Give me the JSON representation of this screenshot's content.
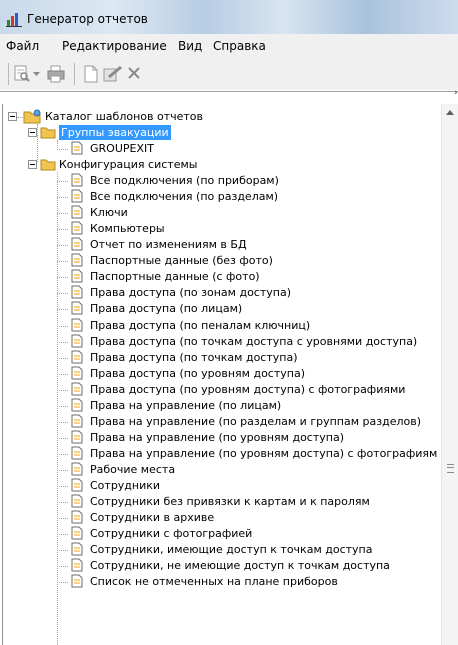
{
  "window": {
    "title": "Генератор отчетов"
  },
  "menu": [
    "Файл",
    "Редактирование",
    "Вид",
    "Справка"
  ],
  "toolbar": {
    "icons": [
      "report-preview-icon",
      "dropdown-arrow-icon",
      "print-icon",
      "new-document-icon",
      "edit-icon",
      "delete-icon"
    ]
  },
  "tree": {
    "root": "Каталог шаблонов отчетов",
    "groups": [
      {
        "label": "Группы эвакуации",
        "selected": true,
        "items": [
          "GROUPEXIT"
        ]
      },
      {
        "label": "Конфигурация системы",
        "selected": false,
        "items": [
          "Все подключения (по приборам)",
          "Все подключения (по разделам)",
          "Ключи",
          "Компьютеры",
          "Отчет по изменениям в БД",
          "Паспортные данные (без фото)",
          "Паспортные данные (с фото)",
          "Права доступа (по зонам доступа)",
          "Права доступа (по лицам)",
          "Права доступа (по пеналам ключниц)",
          "Права доступа (по точкам доступа с уровнями доступа)",
          "Права доступа (по точкам доступа)",
          "Права доступа (по уровням доступа)",
          "Права доступа (по уровням доступа) с фотографиями",
          "Права на управление (по лицам)",
          "Права на управление (по разделам и группам разделов)",
          "Права на управление (по уровням доступа)",
          "Права на управление (по уровням доступа) с фотографиям",
          "Рабочие места",
          "Сотрудники",
          "Сотрудники без привязки к картам и к паролям",
          "Сотрудники в архиве",
          "Сотрудники с фотографией",
          "Сотрудники, имеющие доступ к точкам доступа",
          "Сотрудники, не имеющие доступ к точкам доступа",
          "Список не отмеченных на плане приборов"
        ]
      }
    ]
  },
  "colors": {
    "selection": "#3399ff",
    "folder": "#f2c44e"
  }
}
